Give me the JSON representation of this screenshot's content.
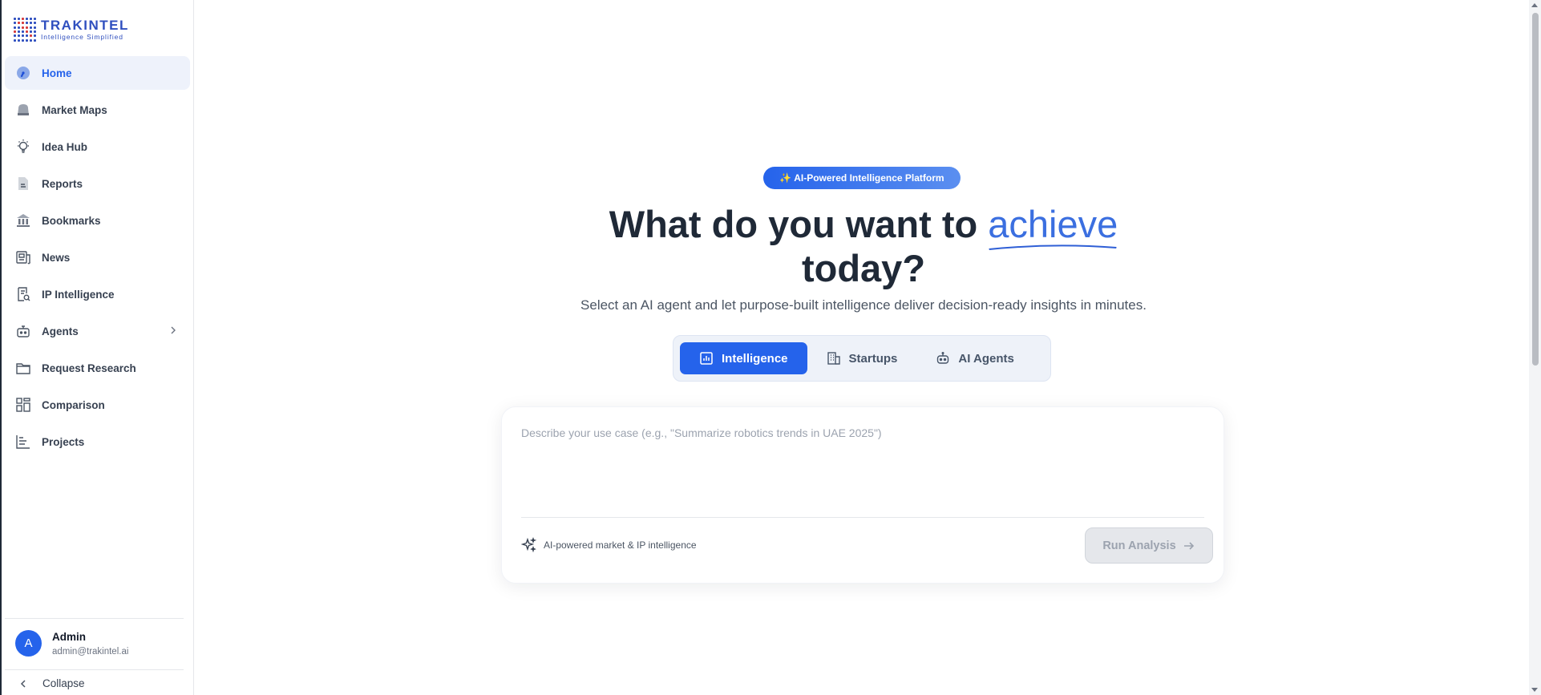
{
  "brand": {
    "name": "TRAKINTEL",
    "tagline": "Intelligence Simplified"
  },
  "sidebar": {
    "items": [
      {
        "label": "Home",
        "icon": "gauge-icon",
        "active": true
      },
      {
        "label": "Market Maps",
        "icon": "bag-icon"
      },
      {
        "label": "Idea Hub",
        "icon": "lightbulb-icon"
      },
      {
        "label": "Reports",
        "icon": "document-icon"
      },
      {
        "label": "Bookmarks",
        "icon": "bank-icon"
      },
      {
        "label": "News",
        "icon": "newspaper-icon"
      },
      {
        "label": "IP Intelligence",
        "icon": "search-document-icon"
      },
      {
        "label": "Agents",
        "icon": "robot-icon",
        "has_submenu": true
      },
      {
        "label": "Request Research",
        "icon": "folder-icon"
      },
      {
        "label": "Comparison",
        "icon": "grid-icon"
      },
      {
        "label": "Projects",
        "icon": "chart-icon"
      }
    ],
    "user": {
      "initial": "A",
      "name": "Admin",
      "email": "admin@trakintel.ai"
    },
    "collapse_label": "Collapse"
  },
  "main": {
    "badge": "✨ AI-Powered Intelligence Platform",
    "headline_part1": "What do you want to ",
    "headline_accent": "achieve",
    "headline_part2": "today?",
    "subtitle": "Select an AI agent and let purpose-built intelligence deliver decision-ready insights in minutes.",
    "tabs": [
      {
        "label": "Intelligence",
        "icon": "bar-chart-icon",
        "active": true
      },
      {
        "label": "Startups",
        "icon": "building-icon"
      },
      {
        "label": "AI Agents",
        "icon": "robot-icon"
      }
    ],
    "prompt": {
      "value": "",
      "placeholder": "Describe your use case (e.g., \"Summarize robotics trends in UAE 2025\")"
    },
    "hint": "AI-powered market & IP intelligence",
    "run_label": "Run Analysis"
  },
  "colors": {
    "accent": "#2563eb",
    "active_bg": "#eef2fb",
    "disabled_bg": "#e5e7eb"
  }
}
